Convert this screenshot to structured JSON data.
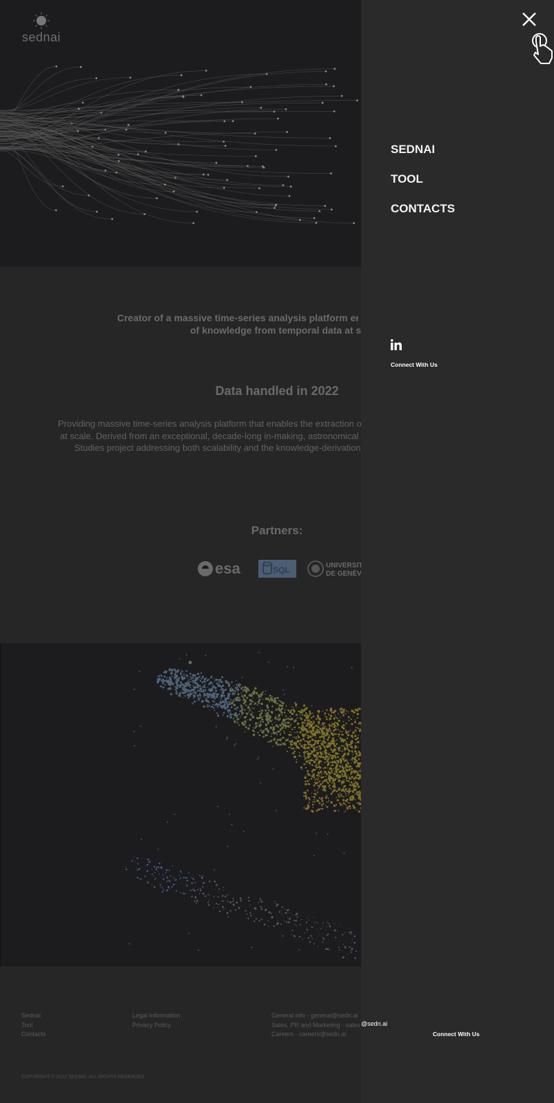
{
  "logo": {
    "text": "sednai"
  },
  "hero": {
    "tagline_line1": "Creator of a massive time-series analysis platform enabli",
    "tagline_line2": "of knowledge from temporal data at scal"
  },
  "data_section": {
    "title": "Data handled in 2022",
    "desc_line1": "Providing massive time-series analysis platform that enables the extraction of",
    "desc_line2": "at scale. Derived from an exceptional, decade-long in-making, astronomical f",
    "desc_line3": "Studies project addressing both scalability and the knowledge-derivation"
  },
  "partners": {
    "title": "Partners:",
    "esa": "esa",
    "sql": "SQL",
    "unige_line1": "UNIVERSIT",
    "unige_line2": "DE GENÈV"
  },
  "footer": {
    "col1": [
      "Sednai",
      "Tool",
      "Contacts"
    ],
    "col2": [
      "Legal Information",
      "Privacy Policy"
    ],
    "col3": [
      "General info - general@sedn.ai",
      "Sales, PR and Marketing - sales",
      "Careers - careers@sedn.ai"
    ],
    "col3_overlay": "@sedn.ai",
    "connect": "Connect With Us",
    "copyright": "COPYRIGHT © 2022 SEDNAI. ALL RIGHTS RESERVED"
  },
  "panel": {
    "nav": [
      "SEDNAI",
      "TOOL",
      "CONTACTS"
    ],
    "connect": "Connect With Us",
    "icons": {
      "close": "close-icon",
      "pointer": "hand-pointer-icon",
      "linkedin": "linkedin-icon"
    }
  },
  "colors": {
    "overlay_bg": "#262626",
    "panel_bg": "#2a2a2a",
    "hero_bg": "#1c1c1e",
    "text_dim": "#6a6a6a",
    "panel_text": "#f2f2f2"
  }
}
